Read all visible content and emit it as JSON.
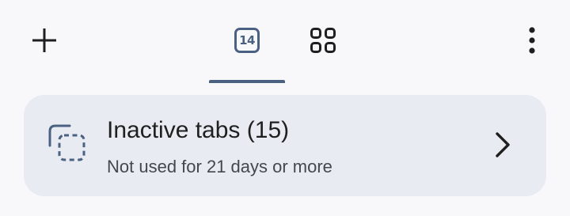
{
  "toolbar": {
    "new_tab_icon": "plus-icon",
    "tab_count": "14",
    "tab_groups_icon": "tab-groups-grid-icon",
    "more_icon": "more-vertical-icon",
    "accent_color": "#4b6182"
  },
  "inactive_card": {
    "title": "Inactive tabs (15)",
    "subtitle": "Not used for 21 days or more",
    "icon": "inactive-tabs-icon",
    "chevron_icon": "chevron-right-icon",
    "background": "#e9ebf2"
  }
}
